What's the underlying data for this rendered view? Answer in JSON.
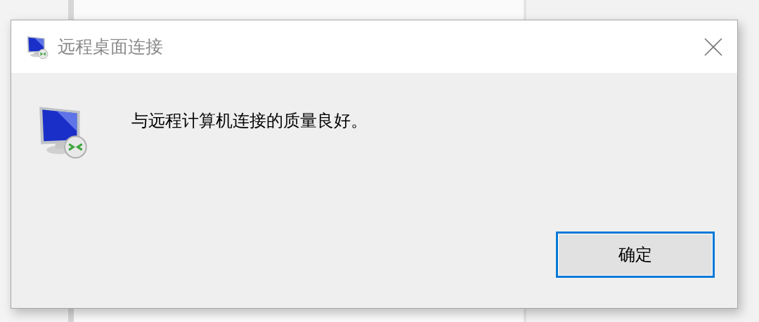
{
  "window": {
    "title": "远程桌面连接"
  },
  "message": "与远程计算机连接的质量良好。",
  "buttons": [
    {
      "label": "确定",
      "default": true
    }
  ]
}
